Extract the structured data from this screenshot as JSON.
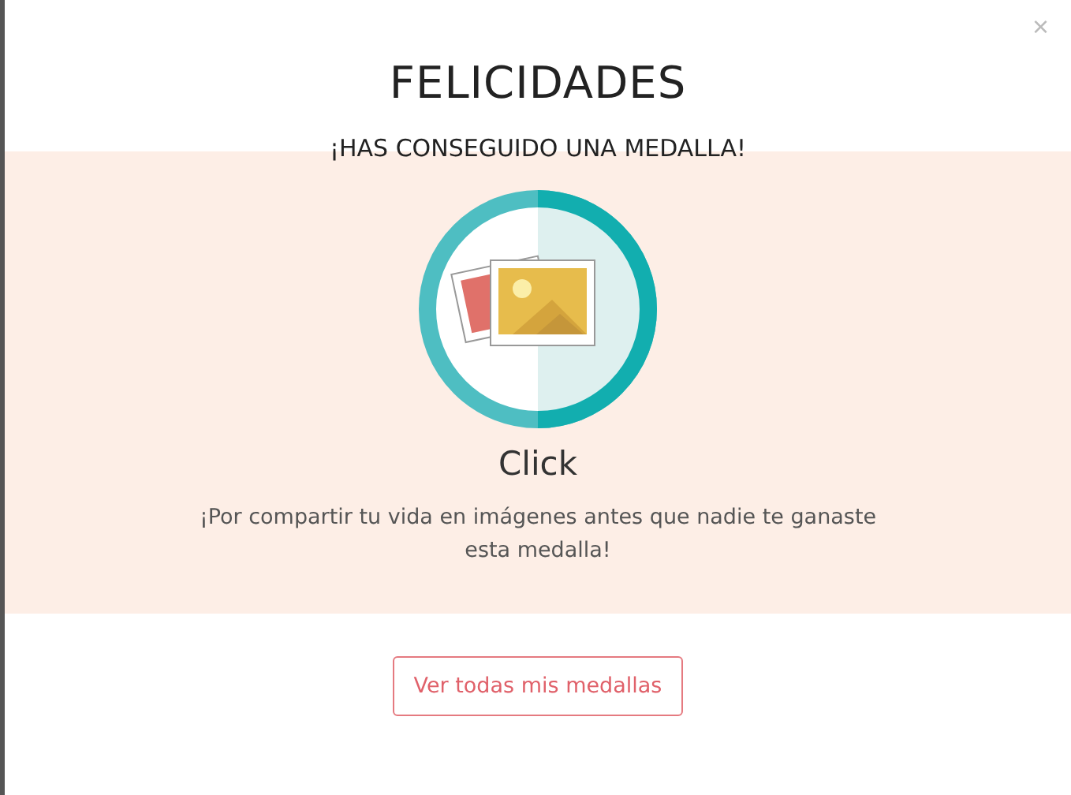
{
  "close": "×",
  "title": "FELICIDADES",
  "subtitle": "¡HAS CONSEGUIDO UNA MEDALLA!",
  "medal": {
    "name": "Click",
    "description": "¡Por compartir tu vida en imágenes antes que nadie te ganaste esta medalla!"
  },
  "button": "Ver todas mis medallas"
}
